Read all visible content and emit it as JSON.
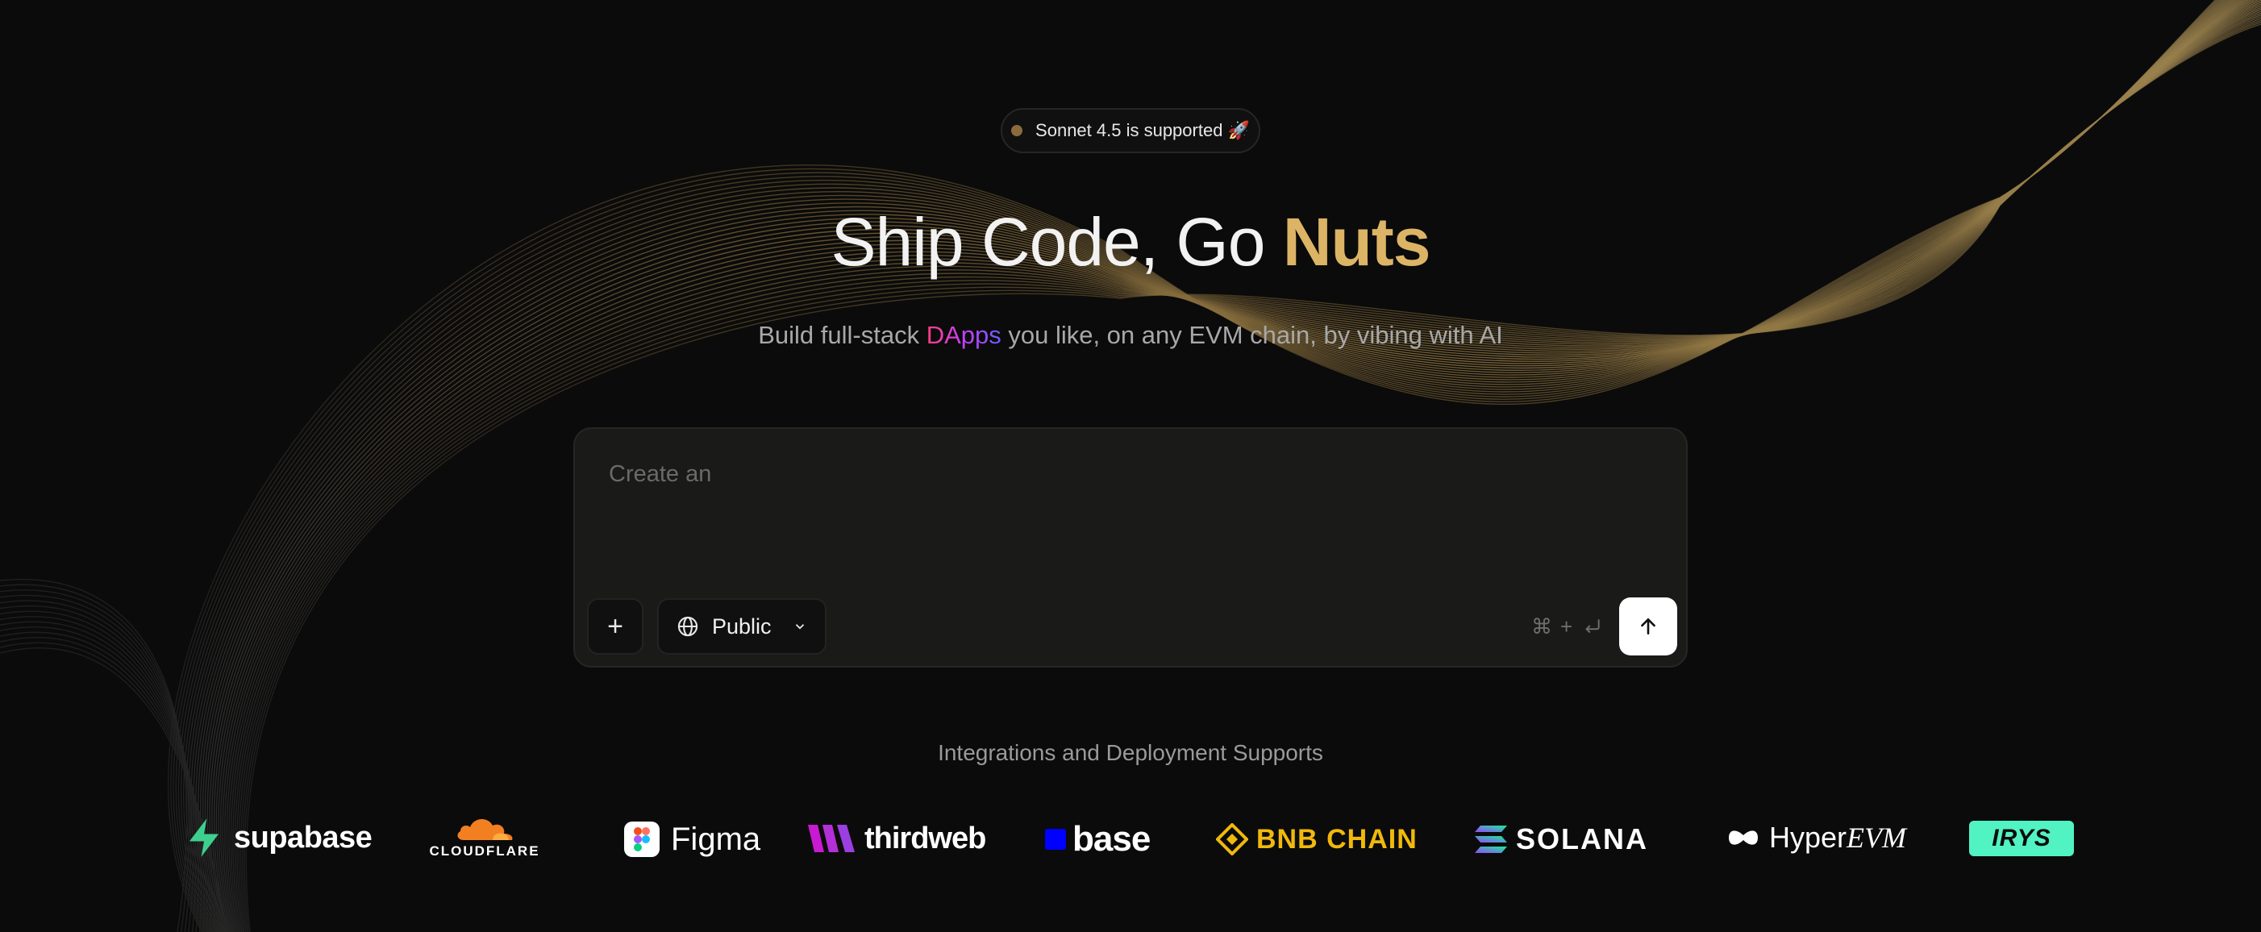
{
  "announcement": {
    "text": "Sonnet 4.5 is supported 🚀",
    "dot_color": "#8a6c3c"
  },
  "hero": {
    "title_main": "Ship Code, Go ",
    "title_accent": "Nuts",
    "accent_color": "#dcb466",
    "subtitle_before": "Build full-stack ",
    "subtitle_highlight": "DApps",
    "subtitle_after": " you like, on any EVM chain, by vibing with AI"
  },
  "prompt": {
    "placeholder": "Create an",
    "value": "",
    "add_label": "+",
    "visibility": {
      "selected": "Public",
      "icon": "globe-icon"
    },
    "shortcut": {
      "modifier": "⌘",
      "plus": "+",
      "key_icon": "return-key-icon"
    },
    "send_icon": "arrow-up-icon"
  },
  "integrations": {
    "heading": "Integrations and Deployment Supports",
    "logos": [
      {
        "name": "supabase",
        "text": "supabase",
        "color": "#3ecf8e"
      },
      {
        "name": "cloudflare",
        "text": "CLOUDFLARE",
        "color": "#f38020"
      },
      {
        "name": "figma",
        "text": "Figma"
      },
      {
        "name": "thirdweb",
        "text": "thirdweb",
        "color": "#c81ad0"
      },
      {
        "name": "base",
        "text": "base",
        "color": "#0000ff"
      },
      {
        "name": "bnb-chain",
        "text": "BNB CHAIN",
        "color": "#f0b90b"
      },
      {
        "name": "solana",
        "text": "SOLANA",
        "color": "#9945ff"
      },
      {
        "name": "hyperevm",
        "text_main": "Hyper",
        "text_italic": "EVM"
      },
      {
        "name": "irys",
        "text": "IRYS",
        "color": "#51f3c2"
      }
    ]
  }
}
